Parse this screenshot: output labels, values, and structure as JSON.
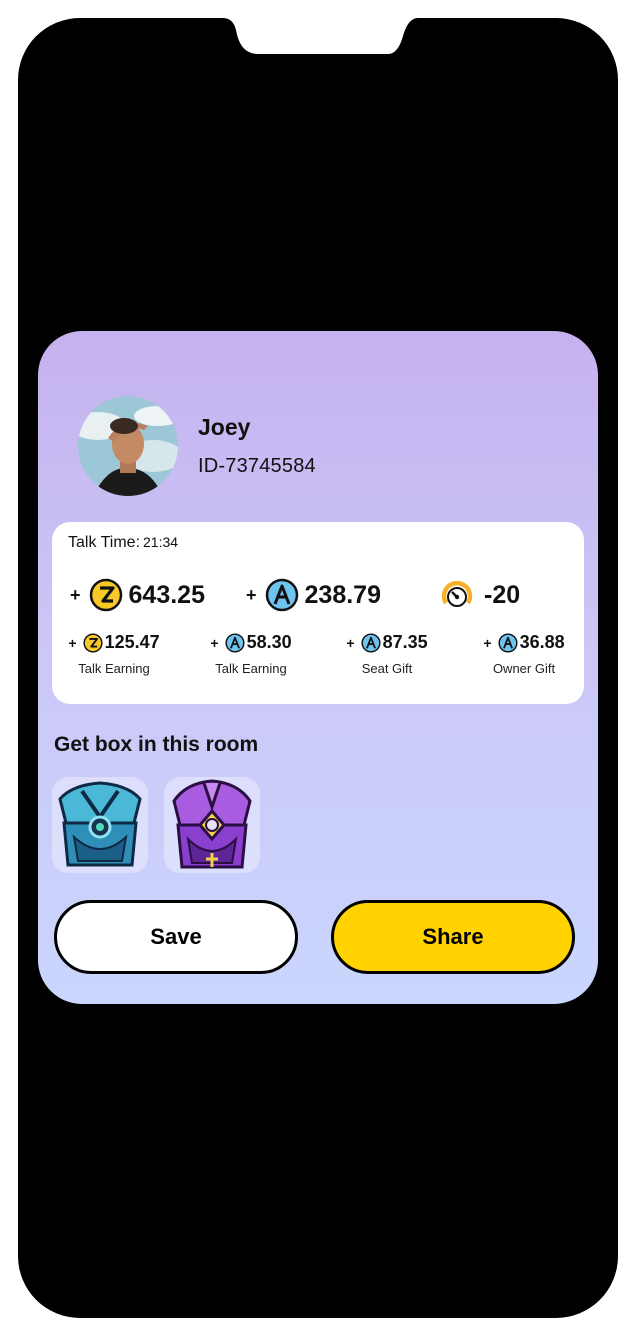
{
  "profile": {
    "name": "Joey",
    "id": "ID-73745584"
  },
  "talk_time": {
    "label": "Talk Time:",
    "value": "21:34"
  },
  "totals": [
    {
      "sign": "+",
      "icon": "z-coin-icon",
      "value": "643.25"
    },
    {
      "sign": "+",
      "icon": "a-coin-icon",
      "value": "238.79"
    },
    {
      "icon": "gauge-icon",
      "value": "-20"
    }
  ],
  "breakdown": [
    {
      "sign": "+",
      "icon": "z-coin-icon",
      "value": "125.47",
      "caption": "Talk Earning"
    },
    {
      "sign": "+",
      "icon": "a-coin-icon",
      "value": "58.30",
      "caption": "Talk Earning"
    },
    {
      "sign": "+",
      "icon": "a-coin-icon",
      "value": "87.35",
      "caption": "Seat Gift"
    },
    {
      "sign": "+",
      "icon": "a-coin-icon",
      "value": "36.88",
      "caption": "Owner Gift"
    }
  ],
  "boxes": {
    "title": "Get box in this room",
    "items": [
      "blue-chest-icon",
      "purple-chest-icon"
    ]
  },
  "buttons": {
    "save": "Save",
    "share": "Share"
  },
  "colors": {
    "accent_yellow": "#ffd200",
    "coin_yellow": "#f6c927",
    "coin_blue": "#6fc3ef",
    "card_top": "#c5b2ef",
    "card_bottom": "#cad6fe"
  }
}
